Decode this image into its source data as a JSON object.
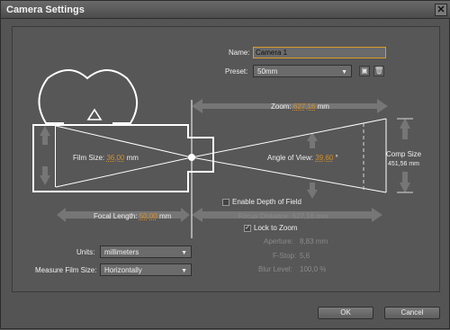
{
  "window": {
    "title": "Camera Settings",
    "close_glyph": "✕"
  },
  "camera": {
    "name_label": "Name:",
    "name_value": "Camera 1",
    "preset_label": "Preset:",
    "preset_value": "50mm"
  },
  "diagram": {
    "zoom_label": "Zoom:",
    "zoom_value": "627,16",
    "zoom_unit": "mm",
    "film_size_label": "Film Size:",
    "film_size_value": "36,00",
    "film_size_unit": "mm",
    "angle_label": "Angle of View:",
    "angle_value": "39,60",
    "angle_unit": "°",
    "comp_size_label": "Comp Size",
    "comp_size_value": "451,56 mm",
    "focal_length_label": "Focal Length:",
    "focal_length_value": "50,00",
    "focal_length_unit": "mm"
  },
  "dof": {
    "enable_label": "Enable Depth of Field",
    "enable_checked": false,
    "focus_distance_label": "Focus Distance:",
    "focus_distance_value": "627,16 mm",
    "lock_to_zoom_label": "Lock to Zoom",
    "lock_to_zoom_checked": true,
    "aperture_label": "Aperture:",
    "aperture_value": "8,83 mm",
    "fstop_label": "F-Stop:",
    "fstop_value": "5,6",
    "blur_label": "Blur Level:",
    "blur_value": "100,0 %"
  },
  "units": {
    "units_label": "Units:",
    "units_value": "millimeters",
    "measure_label": "Measure Film Size:",
    "measure_value": "Horizontally"
  },
  "buttons": {
    "ok": "OK",
    "cancel": "Cancel"
  },
  "colors": {
    "accent": "#d58e2a",
    "background": "#545454",
    "diagram_line": "#ffffff",
    "arrow_fill": "#7a7a7a"
  },
  "icons": {
    "save_preset": "save-icon",
    "delete_preset": "trash-icon",
    "dropdown": "chevron-down-icon",
    "close": "close-icon"
  }
}
